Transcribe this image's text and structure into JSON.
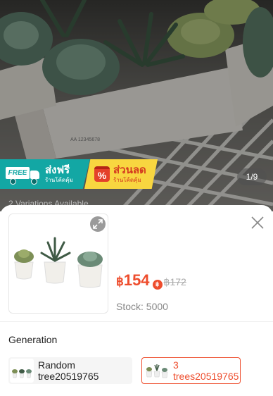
{
  "gallery": {
    "counter": "1/9",
    "promo": {
      "free_ship_badge": "FREE",
      "free_ship_title": "ส่งฟรี",
      "free_ship_sub": "ร้านโค้ดคุ้ม",
      "discount_icon": "%",
      "discount_title": "ส่วนลด",
      "discount_sub": "ร้านโค้ดคุ้ม"
    },
    "variations_peek": "2 Variations Available"
  },
  "sheet": {
    "currency": "฿",
    "price": "154",
    "coin_badge": "฿",
    "old_price": "฿172",
    "stock": "Stock: 5000",
    "group_label": "Generation",
    "options": [
      {
        "label": "Random tree20519765",
        "selected": false
      },
      {
        "label": "3 trees20519765",
        "selected": true
      }
    ]
  },
  "icons": {
    "expand": "expand-icon",
    "close": "close-icon"
  },
  "colors": {
    "accent": "#ee4d2d",
    "free_ship": "#13a7a4",
    "discount": "#f8d640"
  }
}
